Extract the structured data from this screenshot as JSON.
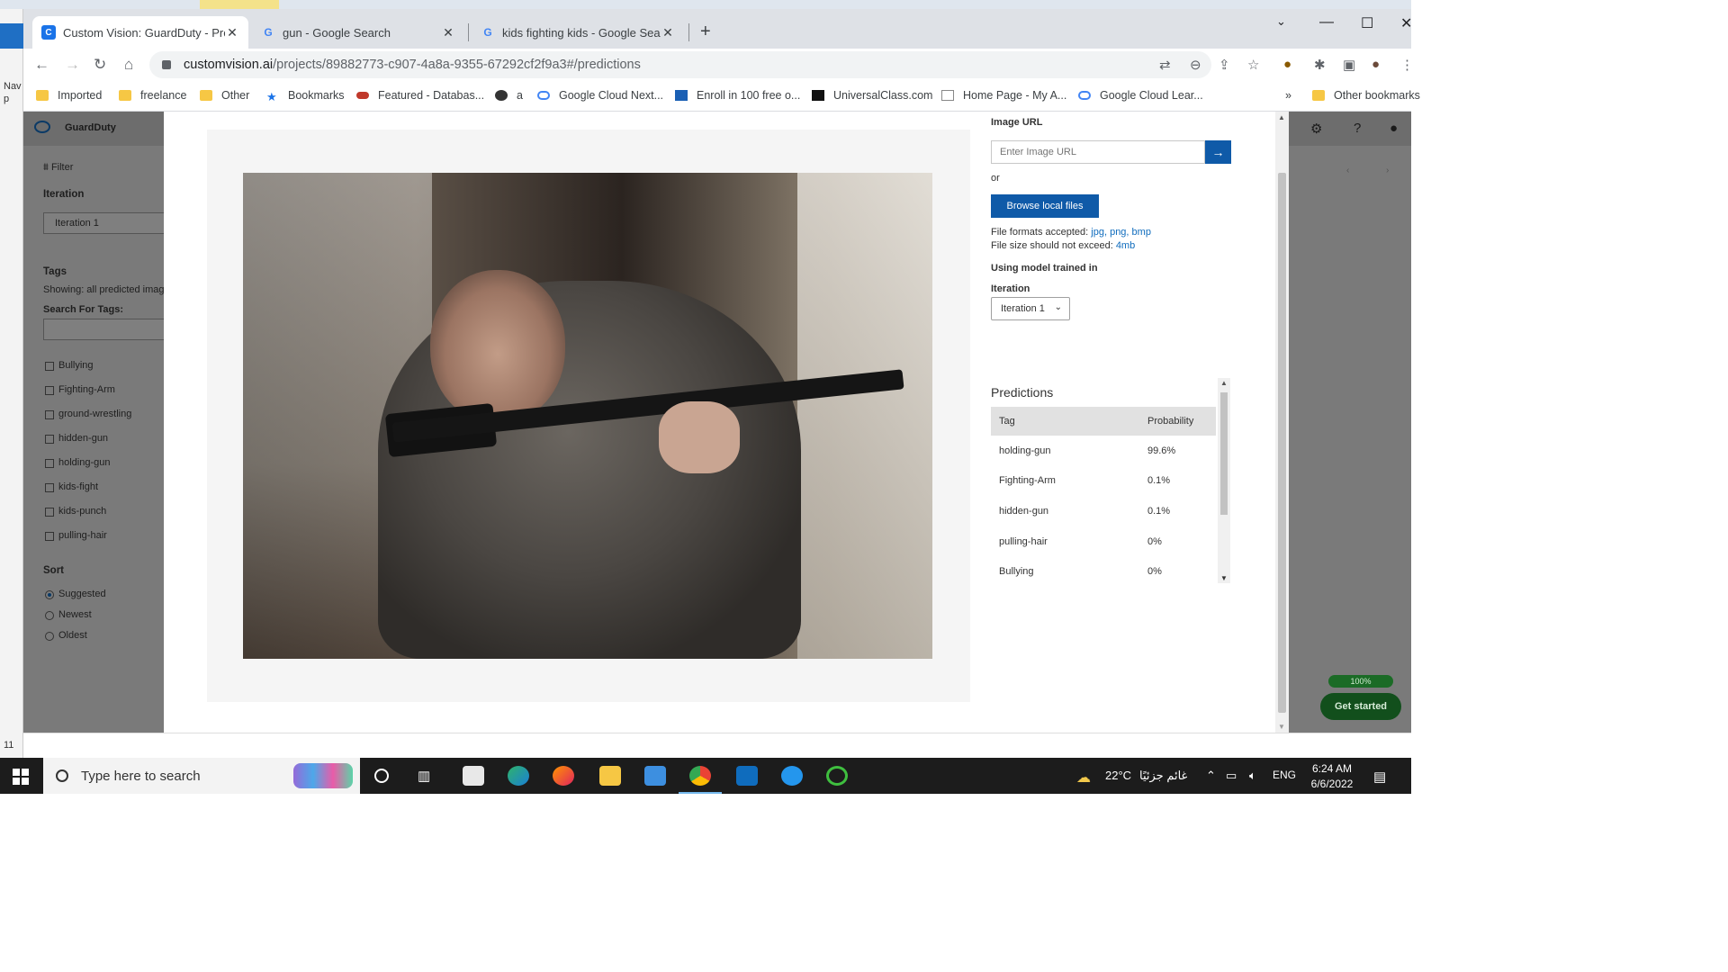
{
  "tabs": [
    {
      "title": "Custom Vision: GuardDuty - Predictions",
      "favicon": "C"
    },
    {
      "title": "gun - Google Search",
      "favicon": "G"
    },
    {
      "title": "kids fighting kids - Google Search",
      "favicon": "G"
    }
  ],
  "toolbar": {
    "url_host": "customvision.ai",
    "url_path": "/projects/89882773-c907-4a8a-9355-67292cf2f9a3#/predictions"
  },
  "bookmarks": [
    {
      "label": "Imported",
      "icon": "folder-icon"
    },
    {
      "label": "freelance",
      "icon": "folder-icon"
    },
    {
      "label": "Other",
      "icon": "folder-icon"
    },
    {
      "label": "Bookmarks",
      "icon": "star-icon"
    },
    {
      "label": "Featured - Databas...",
      "icon": "database-icon"
    },
    {
      "label": "a",
      "icon": "github-icon"
    },
    {
      "label": "Google Cloud Next...",
      "icon": "cloud-icon"
    },
    {
      "label": "Enroll in 100 free o...",
      "icon": "page-icon"
    },
    {
      "label": "UniversalClass.com",
      "icon": "universalclass-icon"
    },
    {
      "label": "Home Page - My A...",
      "icon": "document-icon"
    },
    {
      "label": "Google Cloud Lear...",
      "icon": "cloud-icon"
    },
    {
      "label": "Other bookmarks",
      "icon": "folder-icon"
    }
  ],
  "app": {
    "brand": "GuardDuty"
  },
  "sidebar": {
    "filter_label": "Filter",
    "iteration_heading": "Iteration",
    "iteration_value": "Iteration 1",
    "tags_heading": "Tags",
    "showing_text": "Showing: all predicted images",
    "search_tags_label": "Search For Tags:",
    "tags": [
      "Bullying",
      "Fighting-Arm",
      "ground-wrestling",
      "hidden-gun",
      "holding-gun",
      "kids-fight",
      "kids-punch",
      "pulling-hair"
    ],
    "sort_heading": "Sort",
    "sort_options": [
      "Suggested",
      "Newest",
      "Oldest"
    ],
    "sort_selected": "Suggested"
  },
  "modal": {
    "image_url_heading": "Image URL",
    "image_url_placeholder": "Enter Image URL",
    "or_text": "or",
    "browse_button": "Browse local files",
    "formats_prefix": "File formats accepted:",
    "formats_links": "jpg, png, bmp",
    "size_prefix": "File size should not exceed:",
    "size_link": "4mb",
    "model_heading": "Using model trained in",
    "iteration_label": "Iteration",
    "iteration_value": "Iteration 1",
    "predictions_heading": "Predictions",
    "table_headers": [
      "Tag",
      "Probability"
    ],
    "predictions": [
      {
        "tag": "holding-gun",
        "probability": "99.6%"
      },
      {
        "tag": "Fighting-Arm",
        "probability": "0.1%"
      },
      {
        "tag": "hidden-gun",
        "probability": "0.1%"
      },
      {
        "tag": "pulling-hair",
        "probability": "0%"
      },
      {
        "tag": "Bullying",
        "probability": "0%"
      }
    ]
  },
  "right_panel": {
    "progress_label": "100%",
    "get_started_label": "Get started"
  },
  "taskbar": {
    "search_placeholder": "Type here to search",
    "weather": "22°C",
    "weather_text": "غائم جزئيًا",
    "language": "ENG",
    "time": "6:24 AM",
    "date": "6/6/2022"
  },
  "desktop": {
    "left_text_1": "Nav",
    "left_text_2": "p",
    "left_num": "11"
  },
  "colors": {
    "accent": "#0f5aa8",
    "link": "#0f6cbd",
    "overlay": "#7a7a7a",
    "success": "#124f1c"
  }
}
